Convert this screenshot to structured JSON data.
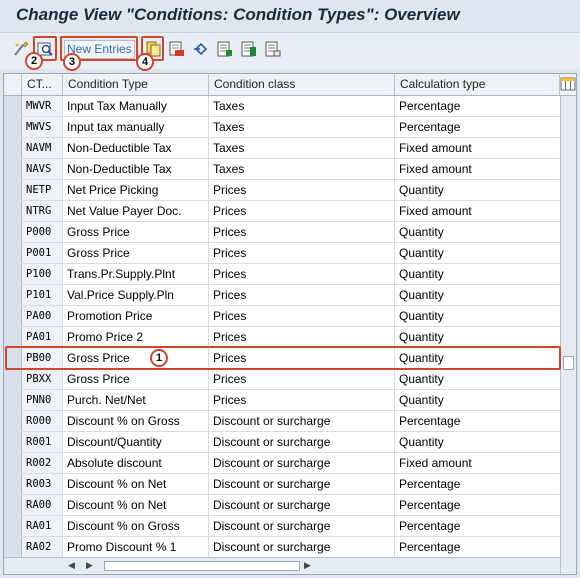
{
  "window": {
    "title": "Change View \"Conditions: Condition Types\": Overview"
  },
  "toolbar": {
    "new_entries_label": "New Entries",
    "icons": [
      "display-change-toggle-icon",
      "details-icon",
      "copy-as-icon",
      "delete-icon",
      "undo-change-icon",
      "select-all-icon",
      "select-block-icon",
      "deselect-all-icon"
    ],
    "annotations": [
      "2",
      "3",
      "4"
    ]
  },
  "table": {
    "columns": [
      "CT...",
      "Condition Type",
      "Condition class",
      "Calculation type"
    ],
    "rows": [
      {
        "code": "MWVR",
        "name": "Input Tax Manually",
        "cls": "Taxes",
        "calc": "Percentage"
      },
      {
        "code": "MWVS",
        "name": "Input tax manually",
        "cls": "Taxes",
        "calc": "Percentage"
      },
      {
        "code": "NAVM",
        "name": "Non-Deductible Tax",
        "cls": "Taxes",
        "calc": "Fixed amount"
      },
      {
        "code": "NAVS",
        "name": "Non-Deductible Tax",
        "cls": "Taxes",
        "calc": "Fixed amount"
      },
      {
        "code": "NETP",
        "name": "Net Price Picking",
        "cls": "Prices",
        "calc": "Quantity"
      },
      {
        "code": "NTRG",
        "name": "Net Value Payer Doc.",
        "cls": "Prices",
        "calc": "Fixed amount"
      },
      {
        "code": "P000",
        "name": "Gross Price",
        "cls": "Prices",
        "calc": "Quantity"
      },
      {
        "code": "P001",
        "name": "Gross Price",
        "cls": "Prices",
        "calc": "Quantity"
      },
      {
        "code": "P100",
        "name": "Trans.Pr.Supply.Plnt",
        "cls": "Prices",
        "calc": "Quantity"
      },
      {
        "code": "P101",
        "name": "Val.Price Supply.Pln",
        "cls": "Prices",
        "calc": "Quantity"
      },
      {
        "code": "PA00",
        "name": "Promotion Price",
        "cls": "Prices",
        "calc": "Quantity"
      },
      {
        "code": "PA01",
        "name": "Promo Price 2",
        "cls": "Prices",
        "calc": "Quantity"
      },
      {
        "code": "PB00",
        "name": "Gross Price",
        "cls": "Prices",
        "calc": "Quantity",
        "highlighted": true,
        "annotation": "1"
      },
      {
        "code": "PBXX",
        "name": "Gross Price",
        "cls": "Prices",
        "calc": "Quantity"
      },
      {
        "code": "PNN0",
        "name": "Purch. Net/Net",
        "cls": "Prices",
        "calc": "Quantity"
      },
      {
        "code": "R000",
        "name": "Discount % on Gross",
        "cls": "Discount or surcharge",
        "calc": "Percentage"
      },
      {
        "code": "R001",
        "name": "Discount/Quantity",
        "cls": "Discount or surcharge",
        "calc": "Quantity"
      },
      {
        "code": "R002",
        "name": "Absolute discount",
        "cls": "Discount or surcharge",
        "calc": "Fixed amount"
      },
      {
        "code": "R003",
        "name": "Discount % on Net",
        "cls": "Discount or surcharge",
        "calc": "Percentage"
      },
      {
        "code": "RA00",
        "name": "Discount % on Net",
        "cls": "Discount or surcharge",
        "calc": "Percentage"
      },
      {
        "code": "RA01",
        "name": "Discount % on Gross",
        "cls": "Discount or surcharge",
        "calc": "Percentage"
      },
      {
        "code": "RA02",
        "name": "Promo Discount % 1",
        "cls": "Discount or surcharge",
        "calc": "Percentage"
      }
    ]
  },
  "colors": {
    "highlight": "#d0452b",
    "header_bg": "#eef2f7",
    "title": "#1c2a3d"
  }
}
